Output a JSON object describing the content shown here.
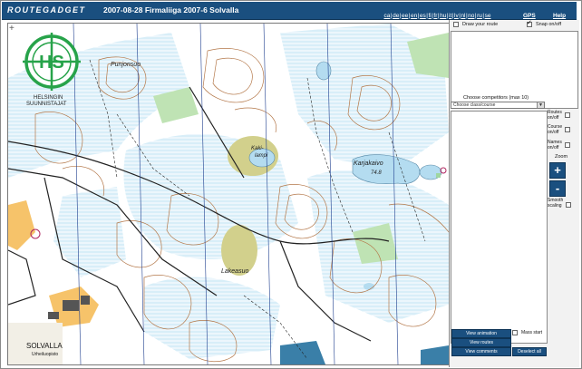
{
  "header": {
    "logo_text": "ROUTEGADGET",
    "title": "2007-08-28 Firmaliiga 2007-6 Solvalla",
    "languages": [
      "ca",
      "de",
      "ee",
      "en",
      "es",
      "fi",
      "fr",
      "hu",
      "it",
      "lv",
      "nl",
      "no",
      "ru",
      "se"
    ],
    "gps_label": "GPS",
    "help_label": "Help"
  },
  "map": {
    "labels": {
      "club_line1": "HELSINGIN",
      "club_line2": "SUUNNISTAJAT",
      "punjonsuo": "Punjonsuo",
      "kakilampi_1": "Kaki-",
      "kakilampi_2": "lampi",
      "karjakaivo": "Karjakaivo",
      "karjakaivo_height": "74.8",
      "lakeasuo": "Lakeasuo",
      "solvalla": "SOLVALLA",
      "urheiluopisto": "Urheiluopisto"
    },
    "colors": {
      "water": "#b4dcf0",
      "marsh": "#d2d08c",
      "contour": "#b4784a",
      "track": "#222222",
      "open": "#f6c36a",
      "vegetation": "#bfe3b4",
      "building": "#555555",
      "control": "#b0265f"
    }
  },
  "sidebar": {
    "draw_route_label": "Draw your route",
    "snap_label": "Snap on/off",
    "snap_checked": true,
    "choose_competitors_label": "Choose competitors (max 10)",
    "class_select_value": "Choose class/course",
    "routes_label": "Routes",
    "routes_toggle": "on/off",
    "course_label": "Course",
    "course_toggle": "on/off",
    "names_label": "Names",
    "names_toggle": "on/off",
    "zoom_label": "Zoom",
    "zoom_in": "+",
    "zoom_out": "-",
    "smooth_label1": "Smooth",
    "smooth_label2": "scaling",
    "view_animation": "View animation",
    "mass_start": "Mass start",
    "view_routes": "View routes",
    "view_comments": "View comments",
    "deselect_all": "Deselect all"
  }
}
